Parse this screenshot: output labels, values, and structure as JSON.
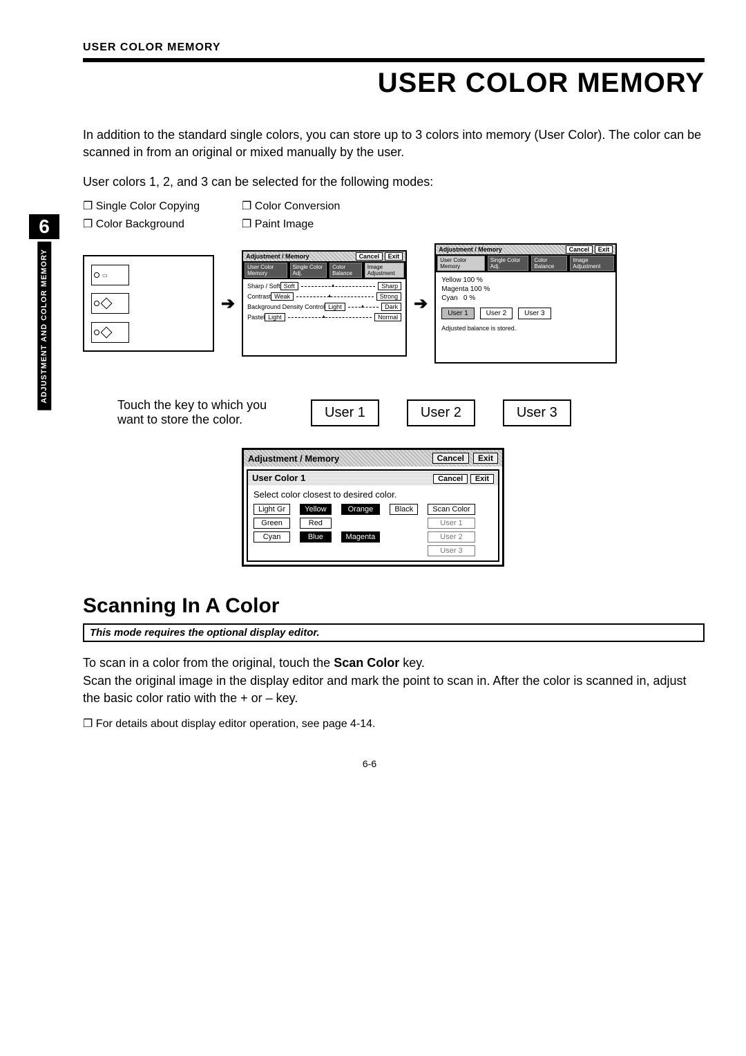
{
  "header": {
    "running": "USER COLOR MEMORY",
    "title": "USER COLOR MEMORY"
  },
  "leftRail": {
    "chapter": "6",
    "label": "ADJUSTMENT\nAND COLOR MEMORY"
  },
  "intro": "In addition to the standard single colors, you can store up to 3 colors into memory (User Color).  The color can be scanned in from an original or mixed manually by the user.",
  "modesLead": "User colors 1, 2, and 3 can be selected for the following modes:",
  "modes": [
    "Single Color Copying",
    "Color Conversion",
    "Color Background",
    "Paint Image"
  ],
  "panelB": {
    "title": "Adjustment / Memory",
    "cancel": "Cancel",
    "exit": "Exit",
    "tabs": [
      "User Color Memory",
      "Single Color Adj.",
      "Color Balance",
      "Image Adjustment"
    ],
    "rows": [
      {
        "label": "Sharp / Soft",
        "left": "Soft",
        "right": "Sharp"
      },
      {
        "label": "Contrast",
        "left": "Weak",
        "right": "Strong"
      },
      {
        "label": "Background Density Control",
        "left": "Light",
        "right": "Dark"
      },
      {
        "label": "Pastel",
        "left": "Light",
        "right": "Normal"
      }
    ]
  },
  "panelC": {
    "title": "Adjustment / Memory",
    "cancel": "Cancel",
    "exit": "Exit",
    "tabs": [
      "User Color Memory",
      "Single Color Adj.",
      "Color Balance",
      "Image Adjustment"
    ],
    "values": [
      {
        "name": "Yellow",
        "pct": "100 %"
      },
      {
        "name": "Magenta",
        "pct": "100 %"
      },
      {
        "name": "Cyan",
        "pct": "0 %"
      }
    ],
    "users": [
      "User 1",
      "User 2",
      "User 3"
    ],
    "note": "Adjusted balance is stored."
  },
  "touch": {
    "text": "Touch the key to which you want to store the color.",
    "buttons": [
      "User  1",
      "User  2",
      "User  3"
    ]
  },
  "dialog": {
    "outerTitle": "Adjustment / Memory",
    "outerCancel": "Cancel",
    "outerExit": "Exit",
    "innerTitle": "User Color 1",
    "innerCancel": "Cancel",
    "innerExit": "Exit",
    "prompt": "Select color closest to desired color.",
    "colorsCol1": [
      "Light Gr",
      "Green",
      "Cyan"
    ],
    "colorsCol2": [
      "Yellow",
      "Red",
      "Blue"
    ],
    "colorsCol3": [
      "Orange",
      "",
      "Magenta"
    ],
    "misc": [
      "Black",
      "Scan Color"
    ],
    "userSlots": [
      "User 1",
      "User 2",
      "User 3"
    ]
  },
  "scanning": {
    "heading": "Scanning In A Color",
    "note": "This mode requires the optional display editor.",
    "para1a": "To scan in a color from the original, touch the ",
    "para1b": "Scan Color",
    "para1c": " key.",
    "para2": "Scan the original image in the display editor and mark the point to scan in.  After the color is scanned in, adjust the basic color ratio with the + or – key.",
    "bullet": "For details about display editor operation, see page 4-14."
  },
  "pageNum": "6-6"
}
